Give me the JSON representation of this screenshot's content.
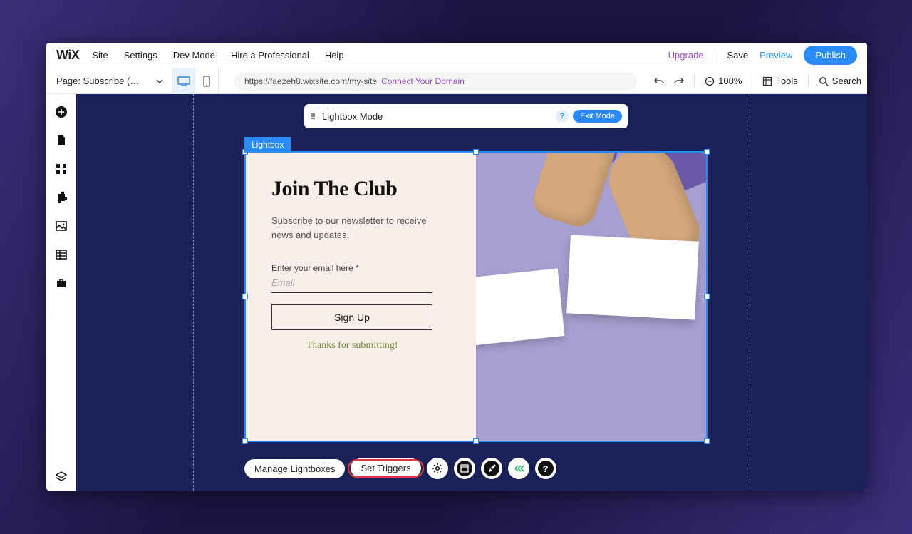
{
  "menubar": {
    "logo": "WiX",
    "items": [
      "Site",
      "Settings",
      "Dev Mode",
      "Hire a Professional",
      "Help"
    ],
    "upgrade": "Upgrade",
    "save": "Save",
    "preview": "Preview",
    "publish": "Publish"
  },
  "toolbar": {
    "page_label": "Page: Subscribe (…",
    "url": "https://faezeh8.wixsite.com/my-site",
    "connect_domain": "Connect Your Domain",
    "zoom": "100%",
    "tools": "Tools",
    "search": "Search"
  },
  "modebar": {
    "label": "Lightbox Mode",
    "help": "?",
    "exit": "Exit Mode"
  },
  "lightbox": {
    "tag": "Lightbox",
    "title": "Join The Club",
    "subtitle": "Subscribe to our newsletter to receive news and updates.",
    "field_label": "Enter your email here *",
    "placeholder": "Email",
    "button": "Sign Up",
    "thanks": "Thanks for submitting!"
  },
  "float": {
    "manage": "Manage Lightboxes",
    "triggers": "Set Triggers"
  }
}
